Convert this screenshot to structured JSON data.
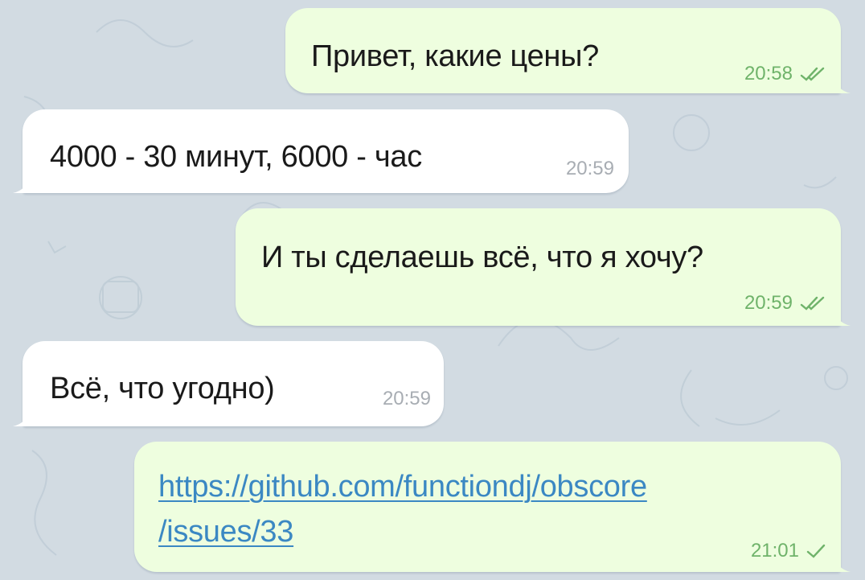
{
  "chat": {
    "messages": [
      {
        "direction": "outgoing",
        "text": "Привет, какие цены?",
        "time": "20:58",
        "status": "read",
        "status_icon": "double-check-icon"
      },
      {
        "direction": "incoming",
        "text": "4000 - 30 минут, 6000 - час",
        "time": "20:59"
      },
      {
        "direction": "outgoing",
        "text": "И ты сделаешь всё, что я хочу?",
        "time": "20:59",
        "status": "read",
        "status_icon": "double-check-icon"
      },
      {
        "direction": "incoming",
        "text": "Всё, что угодно)",
        "time": "20:59"
      },
      {
        "direction": "outgoing",
        "link_line1": "https://github.com/functiondj/obscore",
        "link_line2": "/issues/33",
        "time": "21:01",
        "status": "sent",
        "status_icon": "single-check-icon"
      }
    ]
  },
  "colors": {
    "background": "#d2dbe2",
    "outgoing_bubble": "#eefedf",
    "incoming_bubble": "#ffffff",
    "outgoing_time": "#6fb36a",
    "incoming_time": "#a8adb3",
    "link": "#3b88c3"
  }
}
